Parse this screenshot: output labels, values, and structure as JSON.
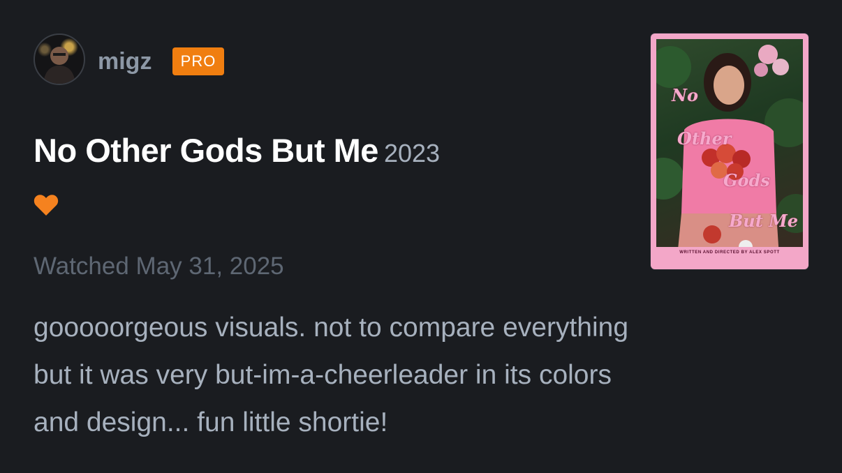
{
  "user": {
    "username": "migz",
    "badge": "PRO"
  },
  "film": {
    "title": "No Other Gods But Me",
    "year": "2023",
    "liked_icon": "heart-icon"
  },
  "watched_label": "Watched May 31, 2025",
  "review": {
    "lines": [
      "gooooorgeous visuals. not to compare everything",
      "but it was very but-im-a-cheerleader in its colors",
      "and design... fun little shortie!"
    ]
  },
  "poster": {
    "title_words": [
      "No",
      "Other",
      "Gods",
      "But Me"
    ],
    "credit": "WRITTEN AND DIRECTED BY ALEX SPOTT"
  },
  "colors": {
    "background": "#1a1c20",
    "accent": "#f07e10",
    "heart": "#f5821f",
    "poster_pink": "#f3a7c8"
  }
}
